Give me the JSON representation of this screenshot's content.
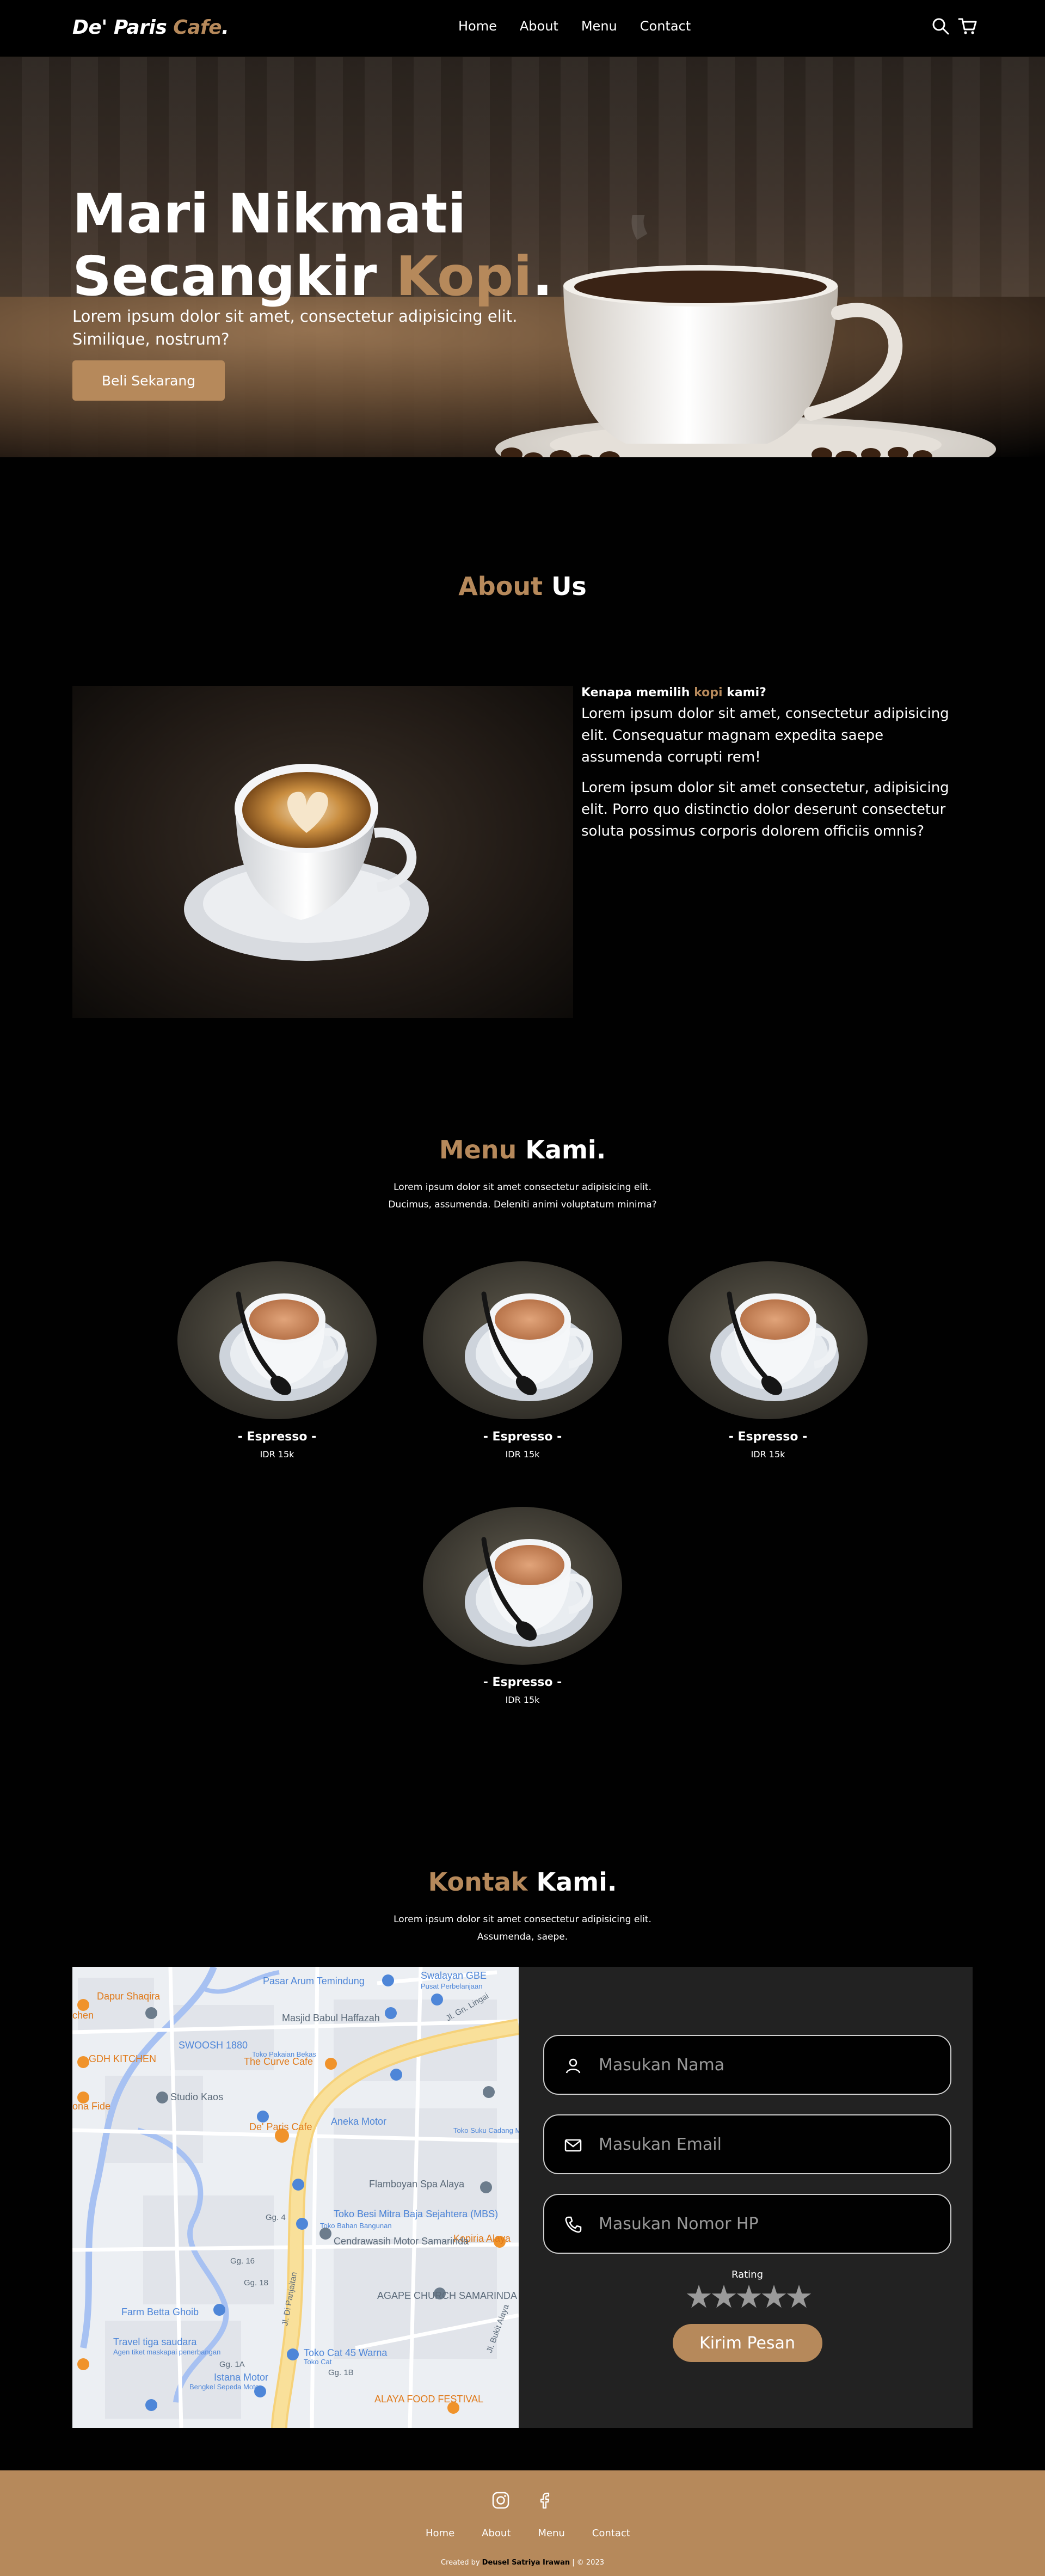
{
  "brand": {
    "name": "De' Paris",
    "accent": "Cafe",
    "dot": "."
  },
  "nav": {
    "links": [
      "Home",
      "About",
      "Menu",
      "Contact"
    ],
    "icons": [
      "search-icon",
      "cart-icon"
    ]
  },
  "hero": {
    "title_line1": "Mari Nikmati",
    "title_line2_prefix": "Secangkir ",
    "title_accent": "Kopi",
    "title_dot": ".",
    "subtitle": "Lorem ipsum dolor sit amet, consectetur adipisicing elit. Similique, nostrum?",
    "button": "Beli Sekarang"
  },
  "about": {
    "title_accent": "About",
    "title_rest": " Us",
    "heading_pre": "Kenapa memilih ",
    "heading_accent": "kopi",
    "heading_post": " kami?",
    "p1": "Lorem ipsum dolor sit amet, consectetur adipisicing elit. Consequatur magnam expedita saepe assumenda corrupti rem!",
    "p2": "Lorem ipsum dolor sit amet consectetur, adipisicing elit. Porro quo distinctio dolor deserunt consectetur soluta possimus corporis dolorem officiis omnis?"
  },
  "menu": {
    "title_accent": "Menu",
    "title_rest": " Kami.",
    "sub_line1": "Lorem ipsum dolor sit amet consectetur adipisicing elit.",
    "sub_line2": "Ducimus, assumenda. Deleniti animi voluptatum minima?",
    "items": [
      {
        "name": "- Espresso -",
        "price": "IDR 15k"
      },
      {
        "name": "- Espresso -",
        "price": "IDR 15k"
      },
      {
        "name": "- Espresso -",
        "price": "IDR 15k"
      },
      {
        "name": "- Espresso -",
        "price": "IDR 15k"
      }
    ]
  },
  "contact": {
    "title_accent": "Kontak",
    "title_rest": " Kami.",
    "sub_line1": "Lorem ipsum dolor sit amet consectetur adipisicing elit.",
    "sub_line2": "Assumenda, saepe.",
    "name_placeholder": "Masukan Nama",
    "email_placeholder": "Masukan Email",
    "phone_placeholder": "Masukan Nomor HP",
    "rating_label": "Rating",
    "stars": "★★★★★",
    "submit": "Kirim Pesan"
  },
  "map_labels": {
    "l1": "Pasar Arum Temindung",
    "l2": "Swalayan GBE",
    "l3": "Pusat Perbelanjaan",
    "l4": "Dapur Shaqira",
    "l5": "Masjid Babul Haffazah",
    "l6": "Jl. Gn. Lingai",
    "l7": "GDH KITCHEN",
    "l8": "The Curve Cafe",
    "l9": "Studio Kaos",
    "l10": "SWOOSH 1880",
    "l11": "Toko Pakaian Bekas",
    "l12": "Aneka Motor",
    "l13": "Toko Suku Cadang Motor",
    "l14": "De' Paris Cafe",
    "l15": "Flamboyan Spa Alaya",
    "l16": "Toko Besi Mitra Baja Sejahtera (MBS)",
    "l17": "Toko Bahan Bangunan",
    "l18": "Cendrawasih Motor Samarinda",
    "l19": "Kopiria Alaya",
    "l20": "AGAPE CHURCH SAMARINDA ALAYA",
    "l21": "Jl. Di Panjaitan",
    "l22": "Farm Betta Ghoib",
    "l23": "Travel tiga saudara",
    "l24": "Agen tiket maskapai penerbangan",
    "l25": "Toko Cat 45 Warna",
    "l26": "Toko Cat",
    "l27": "Istana Motor",
    "l28": "Bengkel Sepeda Motor",
    "l29": "ALAYA FOOD FESTIVAL",
    "l30": "Jl. Bukit Alaya",
    "l31": "Gg. 1B",
    "l32": "Gg. 4",
    "l33": "Gg. 1A",
    "l34": "Gg. 16",
    "l35": "Gg. 18",
    "l36": "chen",
    "l37": "ona Fide"
  },
  "footer": {
    "icons": [
      "instagram-icon",
      "facebook-icon"
    ],
    "links": [
      "Home",
      "About",
      "Menu",
      "Contact"
    ],
    "credit_pre": "Created by ",
    "credit_name": "Deusel Satriya Irawan",
    "credit_post": " | © 2023"
  },
  "colors": {
    "accent": "#b6895b",
    "background": "#010101",
    "panel": "#222222"
  }
}
